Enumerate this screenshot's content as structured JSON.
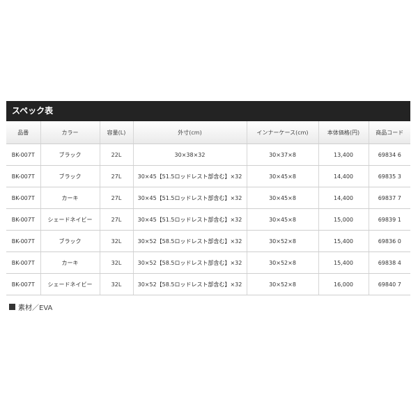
{
  "section_title": "スペック表",
  "table": {
    "headers": [
      "品番",
      "カラー",
      "容量(L)",
      "外寸(cm)",
      "インナーケース(cm)",
      "本体価格(円)",
      "商品コード"
    ],
    "rows": [
      [
        "BK-007T",
        "ブラック",
        "22L",
        "30×38×32",
        "30×37×8",
        "13,400",
        "69834 6"
      ],
      [
        "BK-007T",
        "ブラック",
        "27L",
        "30×45【51.5ロッドレスト部含む】×32",
        "30×45×8",
        "14,400",
        "69835 3"
      ],
      [
        "BK-007T",
        "カーキ",
        "27L",
        "30×45【51.5ロッドレスト部含む】×32",
        "30×45×8",
        "14,400",
        "69837 7"
      ],
      [
        "BK-007T",
        "シェードネイビー",
        "27L",
        "30×45【51.5ロッドレスト部含む】×32",
        "30×45×8",
        "15,000",
        "69839 1"
      ],
      [
        "BK-007T",
        "ブラック",
        "32L",
        "30×52【58.5ロッドレスト部含む】×32",
        "30×52×8",
        "15,400",
        "69836 0"
      ],
      [
        "BK-007T",
        "カーキ",
        "32L",
        "30×52【58.5ロッドレスト部含む】×32",
        "30×52×8",
        "15,400",
        "69838 4"
      ],
      [
        "BK-007T",
        "シェードネイビー",
        "32L",
        "30×52【58.5ロッドレスト部含む】×32",
        "30×52×8",
        "16,000",
        "69840 7"
      ]
    ]
  },
  "material_note": "素材／EVA",
  "colors": {
    "header_bar": "#232323",
    "border": "#cfcfcf"
  }
}
